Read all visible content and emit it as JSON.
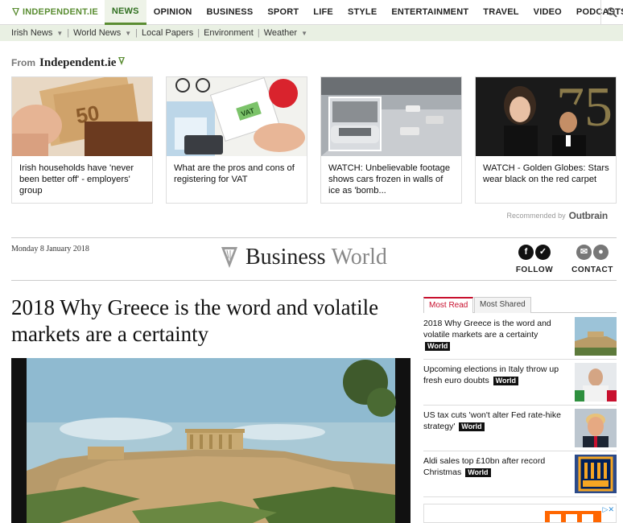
{
  "nav": {
    "brand": "INDEPENDENT.IE",
    "items": [
      "NEWS",
      "OPINION",
      "BUSINESS",
      "SPORT",
      "LIFE",
      "STYLE",
      "ENTERTAINMENT",
      "TRAVEL",
      "VIDEO",
      "PODCASTS"
    ],
    "active": "NEWS"
  },
  "subnav": {
    "items": [
      {
        "label": "Irish News",
        "dropdown": true
      },
      {
        "label": "World News",
        "dropdown": true
      },
      {
        "label": "Local Papers",
        "dropdown": false
      },
      {
        "label": "Environment",
        "dropdown": false
      },
      {
        "label": "Weather",
        "dropdown": true
      }
    ]
  },
  "recommended": {
    "from_label": "From",
    "source": "Independent.ie",
    "cards": [
      {
        "text": "Irish households have 'never been better off' - employers' group",
        "image": "euro-wallet"
      },
      {
        "text": "What are the pros and cons of registering for VAT",
        "image": "vat-desk"
      },
      {
        "text": "WATCH: Unbelievable footage shows cars frozen in walls of ice as 'bomb...",
        "image": "frozen-cars"
      },
      {
        "text": "WATCH - Golden Globes: Stars wear black on the red carpet",
        "image": "golden-globes"
      }
    ],
    "recommended_by": "Recommended by",
    "provider": "Outbrain"
  },
  "section": {
    "date": "Monday 8 January 2018",
    "title_main": "Business",
    "title_sub": "World",
    "follow_label": "FOLLOW",
    "contact_label": "CONTACT"
  },
  "article": {
    "headline": "2018 Why Greece is the word and volatile markets are a certainty",
    "image": "acropolis"
  },
  "sidebar": {
    "tabs": [
      "Most Read",
      "Most Shared"
    ],
    "active_tab": "Most Read",
    "items": [
      {
        "text": "2018 Why Greece is the word and volatile markets are a certainty",
        "badge": "World"
      },
      {
        "text": "Upcoming elections in Italy throw up fresh euro doubts",
        "badge": "World"
      },
      {
        "text": "US tax cuts 'won't alter Fed rate-hike strategy'",
        "badge": "World"
      },
      {
        "text": "Aldi sales top £10bn after record Christmas",
        "badge": "World"
      }
    ]
  },
  "colors": {
    "brand_green": "#5a8d32",
    "most_read_red": "#c8102e"
  }
}
